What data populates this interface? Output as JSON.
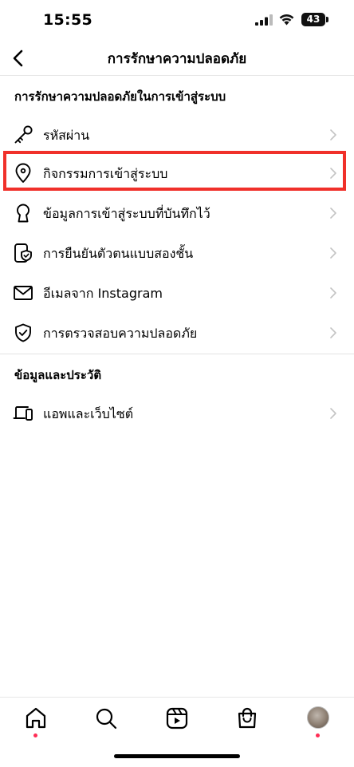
{
  "status_bar": {
    "time": "15:55",
    "battery": "43"
  },
  "header": {
    "title": "การรักษาความปลอดภัย"
  },
  "sections": [
    {
      "heading": "การรักษาความปลอดภัยในการเข้าสู่ระบบ",
      "items": [
        {
          "label": "รหัสผ่าน",
          "icon": "key-icon"
        },
        {
          "label": "กิจกรรมการเข้าสู่ระบบ",
          "icon": "location-pin-icon"
        },
        {
          "label": "ข้อมูลการเข้าสู่ระบบที่บันทึกไว้",
          "icon": "keyhole-icon"
        },
        {
          "label": "การยืนยันตัวตนแบบสองชั้น",
          "icon": "phone-shield-icon"
        },
        {
          "label": "อีเมลจาก Instagram",
          "icon": "mail-icon"
        },
        {
          "label": "การตรวจสอบความปลอดภัย",
          "icon": "shield-check-icon"
        }
      ]
    },
    {
      "heading": "ข้อมูลและประวัติ",
      "items": [
        {
          "label": "แอพและเว็บไซต์",
          "icon": "devices-icon"
        }
      ]
    }
  ],
  "highlight_color": "#f0302a",
  "tab_bar": {
    "tabs": [
      "home-icon",
      "search-icon",
      "reels-icon",
      "shop-icon",
      "profile-avatar"
    ],
    "notification_dot_color": "#ff2d55"
  }
}
